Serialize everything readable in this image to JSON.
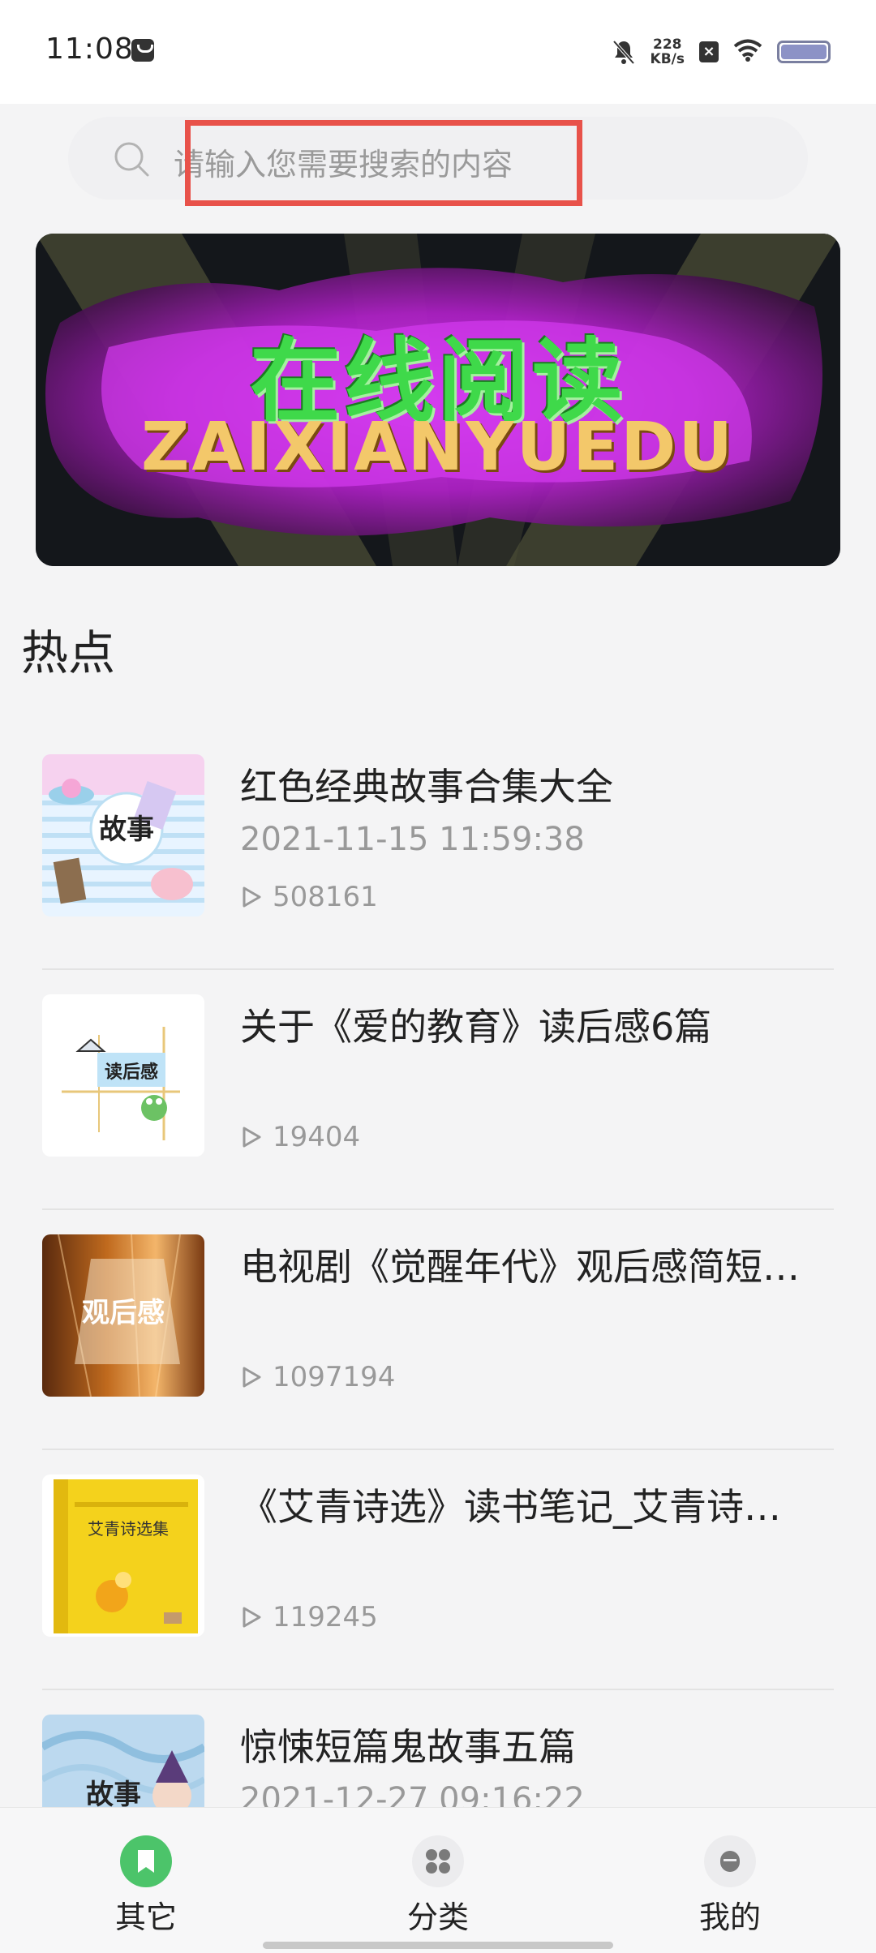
{
  "status_bar": {
    "time": "11:08",
    "net_speed_value": "228",
    "net_speed_unit": "KB/s"
  },
  "search": {
    "placeholder": "请输入您需要搜索的内容"
  },
  "banner": {
    "title_cn": "在线阅读",
    "title_en": "ZAIXIANYUEDU"
  },
  "section": {
    "title": "热点"
  },
  "items": [
    {
      "title": "红色经典故事合集大全",
      "date": "2021-11-15 11:59:38",
      "views": "508161",
      "thumb_text": "故事"
    },
    {
      "title": "关于《爱的教育》读后感6篇",
      "date": "",
      "views": "19404",
      "thumb_text": "读后感"
    },
    {
      "title": "电视剧《觉醒年代》观后感简短…",
      "date": "",
      "views": "1097194",
      "thumb_text": "观后感"
    },
    {
      "title": "《艾青诗选》读书笔记_艾青诗选…",
      "date": "",
      "views": "119245",
      "thumb_text": "艾青诗选集"
    },
    {
      "title": "惊悚短篇鬼故事五篇",
      "date": "2021-12-27 09:16:22",
      "views": "",
      "thumb_text": "故事"
    }
  ],
  "bottom_nav": [
    {
      "label": "其它",
      "icon": "bookmark-icon",
      "color": "#4cc46a",
      "active": true
    },
    {
      "label": "分类",
      "icon": "grid-icon",
      "color": "#7a7a7a",
      "active": false
    },
    {
      "label": "我的",
      "icon": "profile-icon",
      "color": "#7a7a7a",
      "active": false
    }
  ],
  "colors": {
    "accent": "#4cc46a",
    "highlight": "#e8524a"
  }
}
